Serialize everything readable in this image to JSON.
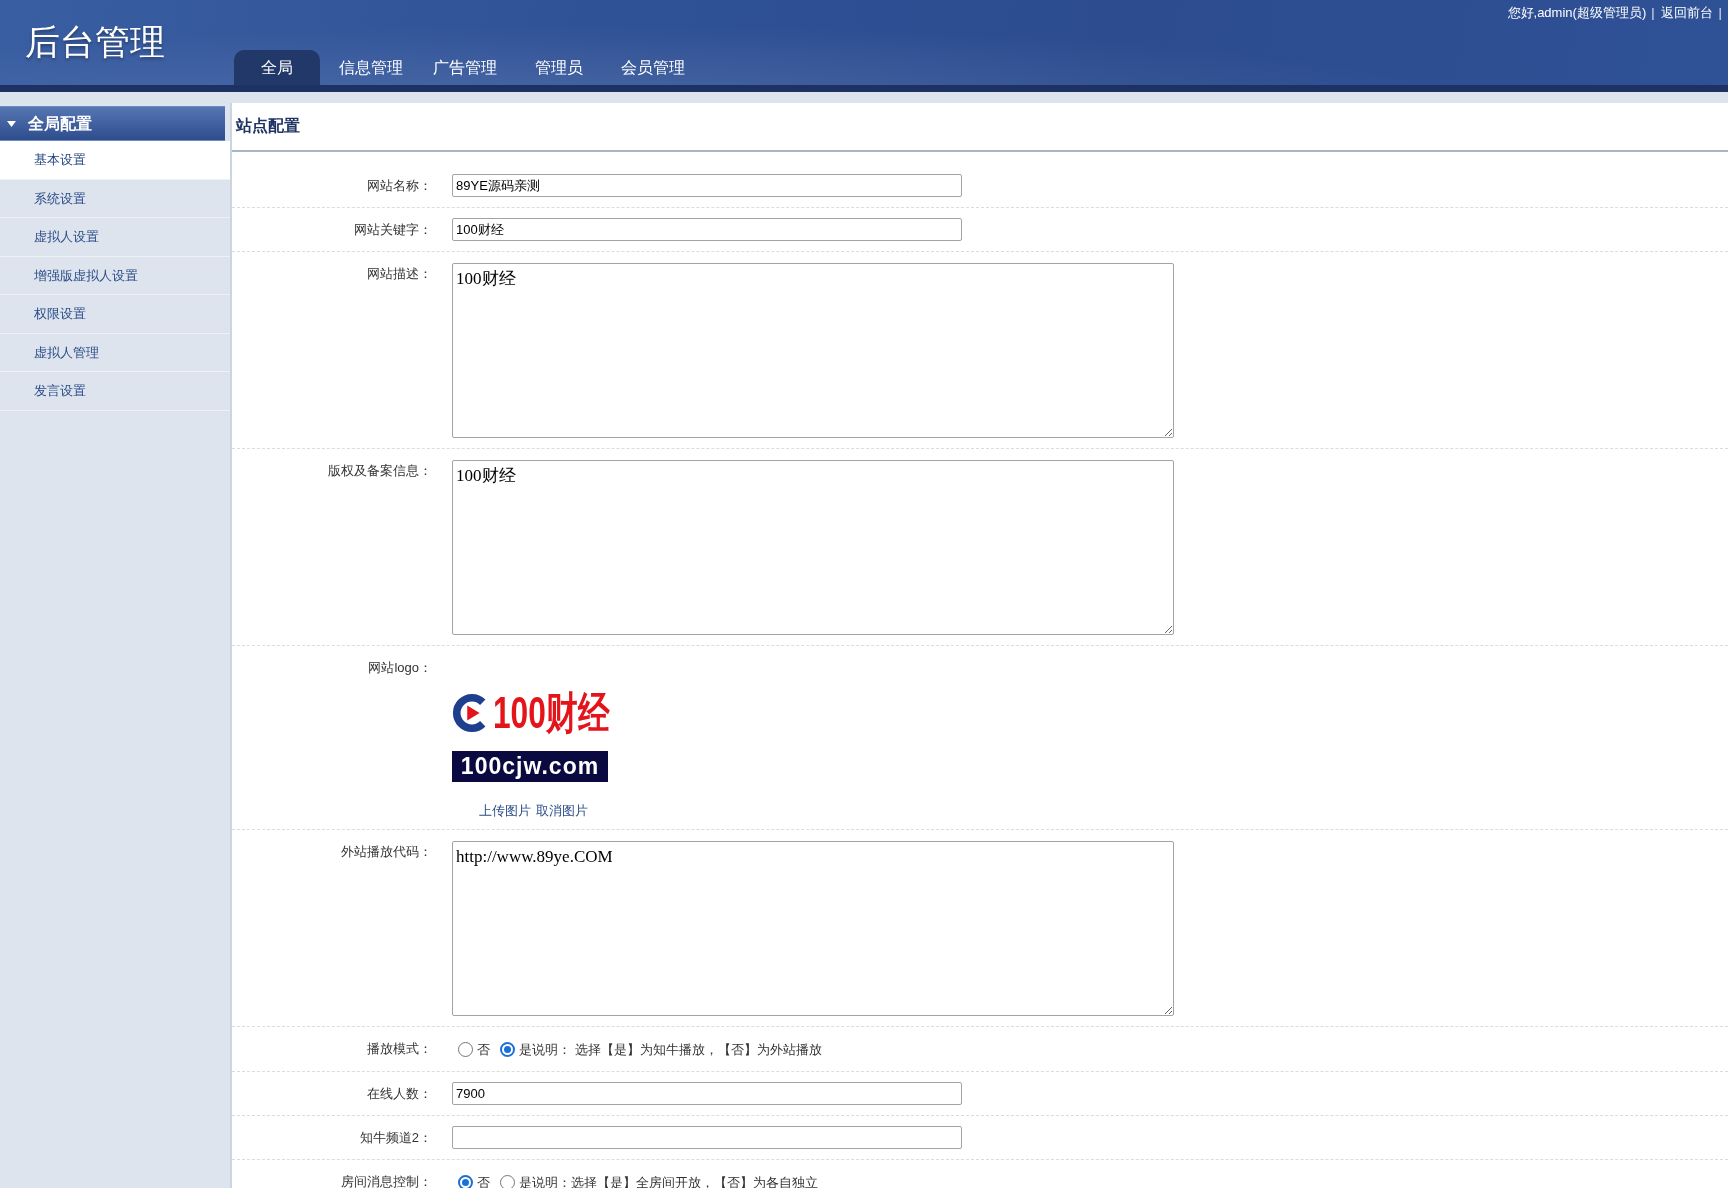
{
  "header": {
    "title": "后台管理",
    "tabs": [
      {
        "label": "全局",
        "selected": true
      },
      {
        "label": "信息管理",
        "selected": false
      },
      {
        "label": "广告管理",
        "selected": false
      },
      {
        "label": "管理员",
        "selected": false
      },
      {
        "label": "会员管理",
        "selected": false
      }
    ],
    "user_bar": [
      {
        "kind": "text",
        "text": "您好,admin(超级管理员)"
      },
      {
        "kind": "separator",
        "text": "|"
      },
      {
        "kind": "link",
        "text": "返回前台"
      },
      {
        "kind": "separator",
        "text": "|"
      }
    ]
  },
  "sidebar": {
    "section": {
      "title": "全局配置",
      "expanded": true
    },
    "items": [
      {
        "label": "基本设置",
        "selected": true
      },
      {
        "label": "系统设置",
        "selected": false
      },
      {
        "label": "虚拟人设置",
        "selected": false
      },
      {
        "label": "增强版虚拟人设置",
        "selected": false
      },
      {
        "label": "权限设置",
        "selected": false
      },
      {
        "label": "虚拟人管理",
        "selected": false
      },
      {
        "label": "发言设置",
        "selected": false
      }
    ]
  },
  "panel": {
    "title": "站点配置",
    "rows": [
      {
        "kind": "input",
        "label": "网站名称：",
        "value": "89YE源码亲测"
      },
      {
        "kind": "input",
        "label": "网站关键字：",
        "value": "100财经"
      },
      {
        "kind": "textarea",
        "label": "网站描述：",
        "value": "100财经"
      },
      {
        "kind": "textarea",
        "label": "版权及备案信息：",
        "value": "100财经"
      },
      {
        "kind": "image",
        "label": "网站logo：",
        "logo": {
          "title": "100财经",
          "domain": "100cjw.com"
        },
        "links": [
          {
            "label": "上传图片"
          },
          {
            "label": "取消图片"
          }
        ]
      },
      {
        "kind": "textarea",
        "label": "外站播放代码：",
        "value": "http://www.89ye.COM"
      },
      {
        "kind": "radio",
        "label": "播放模式：",
        "options": [
          {
            "label": "否",
            "selected": false
          },
          {
            "label": "是",
            "selected": true
          }
        ],
        "note": "说明： 选择【是】为知牛播放，【否】为外站播放"
      },
      {
        "kind": "input",
        "label": "在线人数：",
        "value": "7900"
      },
      {
        "kind": "input",
        "label": "知牛频道2："
      },
      {
        "kind": "radio",
        "label": "房间消息控制：",
        "options": [
          {
            "label": "否",
            "selected": true
          },
          {
            "label": "是",
            "selected": false
          }
        ],
        "note": "说明：选择【是】全房间开放，【否】为各自独立"
      }
    ]
  }
}
